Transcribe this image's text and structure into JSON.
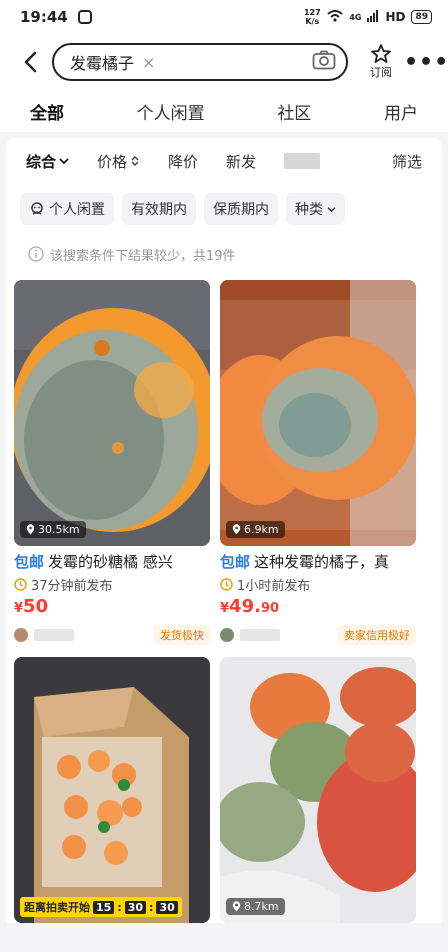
{
  "status": {
    "time": "19:44",
    "speed": "127 K/s",
    "signal": "4G",
    "hd": "HD",
    "battery": "89"
  },
  "header": {
    "query": "发霉橘子",
    "subscribe_label": "订阅"
  },
  "tabs": [
    {
      "label": "全部"
    },
    {
      "label": "个人闲置"
    },
    {
      "label": "社区"
    },
    {
      "label": "用户"
    }
  ],
  "sort": [
    {
      "label": "综合"
    },
    {
      "label": "价格"
    },
    {
      "label": "降价"
    },
    {
      "label": "新发"
    },
    {
      "label": "筛选"
    }
  ],
  "filters": [
    {
      "label": "个人闲置"
    },
    {
      "label": "有效期内"
    },
    {
      "label": "保质期内"
    },
    {
      "label": "种类"
    }
  ],
  "notice": "该搜索条件下结果较少，共19件",
  "items": [
    {
      "distance": "30.5km",
      "tag": "包邮",
      "title": "发霉的砂糖橘 感兴",
      "time": "37分钟前发布",
      "price_symbol": "¥",
      "price_int": "50",
      "price_dec": "",
      "badge": "发货极快"
    },
    {
      "distance": "6.9km",
      "tag": "包邮",
      "title": "这种发霉的橘子，真",
      "time": "1小时前发布",
      "price_symbol": "¥",
      "price_int": "49.",
      "price_dec": "90",
      "badge": "卖家信用极好"
    },
    {
      "auction_label": "距离拍卖开始",
      "auction_h": "15",
      "auction_m": "30",
      "auction_s": "30"
    },
    {
      "distance": "8.7km"
    }
  ]
}
